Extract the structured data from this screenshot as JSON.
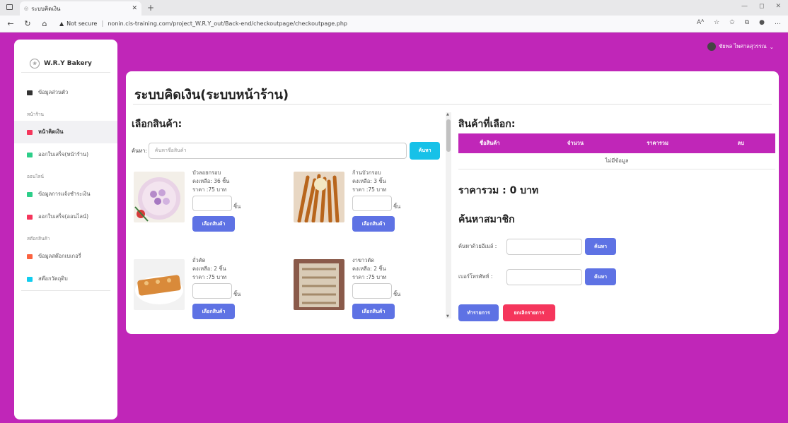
{
  "browser": {
    "tab_title": "ระบบคิดเงิน",
    "url_warning": "Not secure",
    "url": "nonin.cis-training.com/project_W.R.Y_out/Back-end/checkoutpage/checkoutpage.php"
  },
  "sidebar": {
    "brand": "W.R.Y Bakery",
    "profile": "ข้อมูลส่วนตัว",
    "section_store": "หน้าร้าน",
    "checkout": "หน้าคิดเงิน",
    "receipt_store": "ออกใบเสร็จ(หน้าร้าน)",
    "section_online": "ออนไลน์",
    "payment_info": "ข้อมูลการแจ้งชำระเงิน",
    "receipt_online": "ออกใบเสร็จ(ออนไลน์)",
    "section_stock": "สต๊อกสินค้า",
    "stock_bakery": "ข้อมูลสต๊อกเบเกอรี่",
    "stock_material": "สต๊อกวัตถุดิบ"
  },
  "user": {
    "name": "ชัยพล ไพศาลสุวรรณ"
  },
  "page": {
    "title": "ระบบคิดเงิน(ระบบหน้าร้าน)"
  },
  "select_panel": {
    "title": "เลือกสินค้า:",
    "search_label": "ค้นหา:",
    "search_placeholder": "ค้นหาชื่อสินค้า",
    "search_button": "ค้นหา",
    "unit": "ชิ้น",
    "pick_button": "เลือกสินค้า",
    "products": [
      {
        "name": "บัวลอยกรอบ",
        "stock": "คงเหลือ: 36 ชิ้น",
        "price": "ราคา :75 บาท"
      },
      {
        "name": "ก้านบัวกรอบ",
        "stock": "คงเหลือ: 3 ชิ้น",
        "price": "ราคา :75 บาท"
      },
      {
        "name": "ถั่วตัด",
        "stock": "คงเหลือ: 2 ชิ้น",
        "price": "ราคา :75 บาท"
      },
      {
        "name": "งาขาวตัด",
        "stock": "คงเหลือ: 2 ชิ้น",
        "price": "ราคา :75 บาท"
      }
    ]
  },
  "cart": {
    "title": "สินค้าที่เลือก:",
    "columns": [
      "ชื่อสินค้า",
      "จำนวน",
      "ราคารวม",
      "ลบ"
    ],
    "empty": "ไม่มีข้อมูล",
    "total": "ราคารวม : 0 บาท"
  },
  "member": {
    "title": "ค้นหาสมาชิก",
    "email_label": "ค้นหาด้วยอีเมล์ :",
    "phone_label": "เบอร์โทรศัพท์ :",
    "search_button": "ค้นหา",
    "list_button": "ทำรายการ",
    "cancel_button": "ยกเลิกรายการ"
  },
  "colors": {
    "accent": "#c026b8",
    "primary": "#5e72e4",
    "info": "#17c1e8",
    "danger": "#f5365c"
  }
}
